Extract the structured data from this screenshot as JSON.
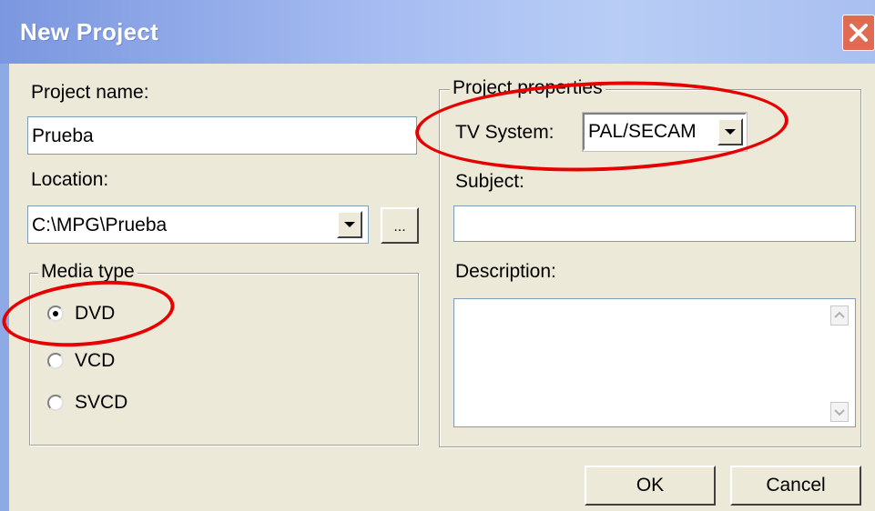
{
  "window": {
    "title": "New Project",
    "close_label": "close"
  },
  "project_name": {
    "label": "Project name:",
    "value": "Prueba"
  },
  "location": {
    "label": "Location:",
    "value": "C:\\MPG\\Prueba",
    "browse_label": "..."
  },
  "media_type": {
    "title": "Media type",
    "options": [
      {
        "label": "DVD",
        "checked": true
      },
      {
        "label": "VCD",
        "checked": false
      },
      {
        "label": "SVCD",
        "checked": false
      }
    ]
  },
  "project_properties": {
    "title": "Project properties",
    "tv_system_label": "TV System:",
    "tv_system_value": "PAL/SECAM",
    "subject_label": "Subject:",
    "subject_value": "",
    "description_label": "Description:",
    "description_value": ""
  },
  "buttons": {
    "ok": "OK",
    "cancel": "Cancel"
  },
  "colors": {
    "annotation": "#e60000",
    "titlebar": "#a7bdf2",
    "dialog_bg": "#ece9d8"
  },
  "icons": [
    "close-icon",
    "chevron-down-icon",
    "chevron-up-icon"
  ]
}
